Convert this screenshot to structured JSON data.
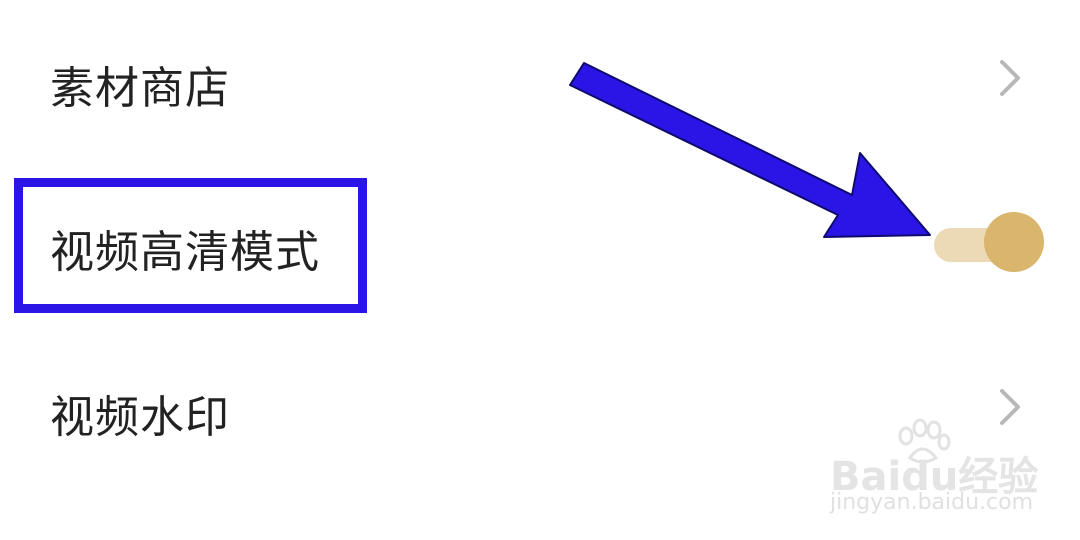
{
  "settings": {
    "items": [
      {
        "label": "素材商店",
        "control": "chevron-right"
      },
      {
        "label": "视频高清模式",
        "control": "toggle",
        "toggle_on": true
      },
      {
        "label": "视频水印",
        "control": "chevron-right"
      }
    ]
  },
  "annotation": {
    "highlight_color": "#2a14e6",
    "arrow_color": "#2a14e6"
  },
  "toggle_colors": {
    "track": "#ecd9b6",
    "knob": "#d9b56d"
  },
  "watermark": {
    "logo_text": "Baidu经验",
    "url": "jingyan.baidu.com"
  }
}
